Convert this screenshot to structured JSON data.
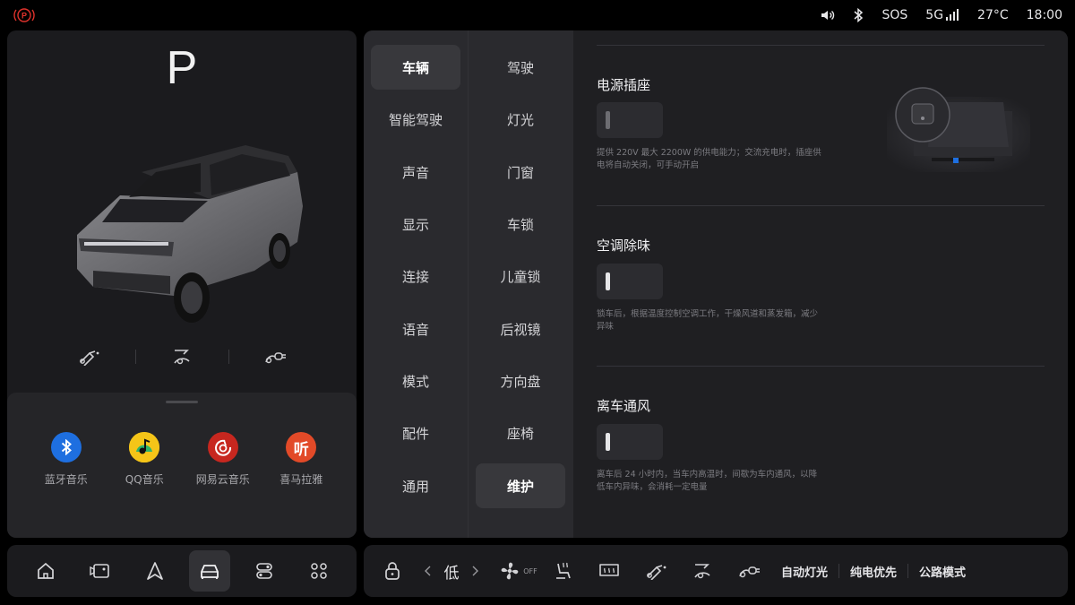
{
  "status": {
    "sos": "SOS",
    "network": "5G",
    "temperature": "27°C",
    "time": "18:00"
  },
  "vehicle": {
    "gear": "P"
  },
  "media": {
    "apps": [
      {
        "label": "蓝牙音乐",
        "icon": "bluetooth-icon",
        "color": "#1e6fe0"
      },
      {
        "label": "QQ音乐",
        "icon": "qq-music-icon",
        "color": "#f5c518"
      },
      {
        "label": "网易云音乐",
        "icon": "netease-music-icon",
        "color": "#c7271f"
      },
      {
        "label": "喜马拉雅",
        "icon": "ximalaya-icon",
        "color": "#e24a28",
        "glyph": "听"
      }
    ]
  },
  "settings": {
    "col1": [
      "车辆",
      "智能驾驶",
      "声音",
      "显示",
      "连接",
      "语音",
      "模式",
      "配件",
      "通用"
    ],
    "col2": [
      "驾驶",
      "灯光",
      "门窗",
      "车锁",
      "儿童锁",
      "后视镜",
      "方向盘",
      "座椅",
      "维护"
    ],
    "col1_active": "车辆",
    "col2_active": "维护",
    "sections": [
      {
        "title": "电源插座",
        "desc": "提供 220V 最大 2200W 的供电能力；交流充电时，插座供电将自动关闭，可手动开启",
        "on": false
      },
      {
        "title": "空调除味",
        "desc": "锁车后，根据温度控制空调工作，干燥风道和蒸发箱，减少异味",
        "on": false
      },
      {
        "title": "离车通风",
        "desc": "离车后 24 小时内，当车内高温时，间歇为车内通风，以降低车内异味，会消耗一定电量",
        "on": false
      }
    ]
  },
  "dock": {
    "fan_level": "低",
    "fan_state": "OFF",
    "auto_light": "自动灯光",
    "ev_priority": "纯电优先",
    "road_mode": "公路模式"
  },
  "colors": {
    "park_red": "#e0322c",
    "panel": "#1b1b1e",
    "accent_blue": "#1e6fe0"
  }
}
